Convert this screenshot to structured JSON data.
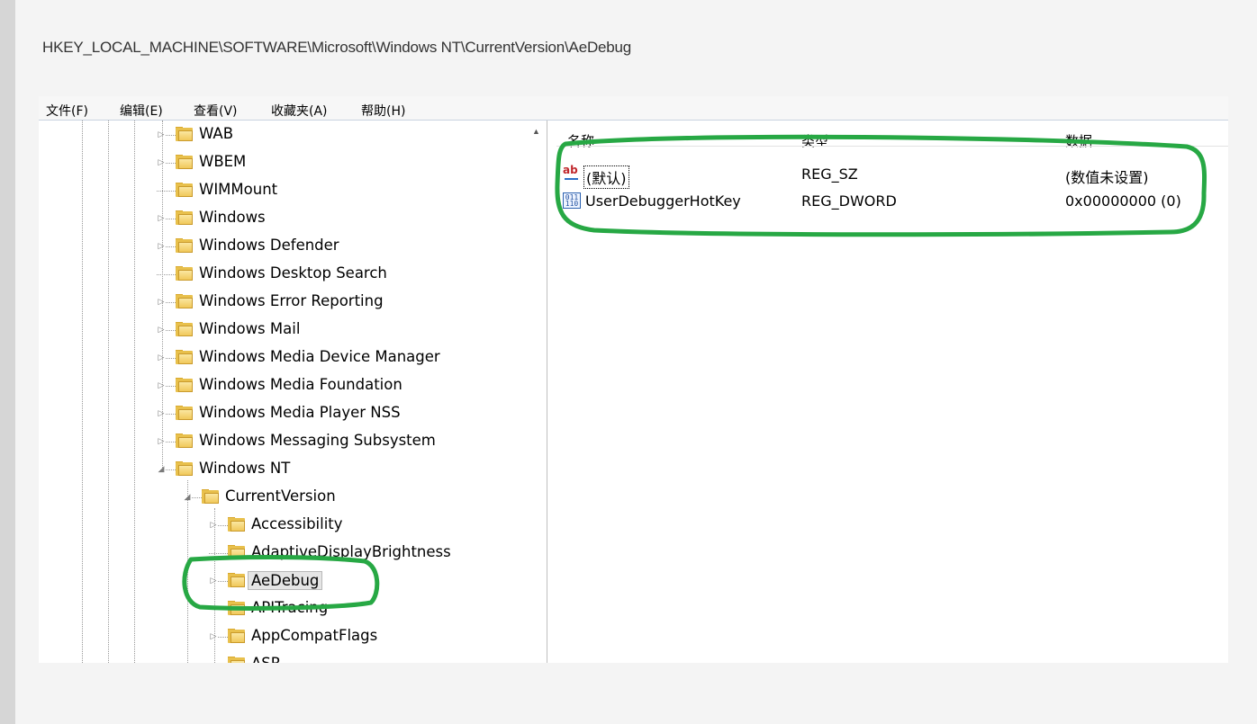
{
  "path": "HKEY_LOCAL_MACHINE\\SOFTWARE\\Microsoft\\Windows NT\\CurrentVersion\\AeDebug",
  "menu": [
    {
      "label": "文件(F)"
    },
    {
      "label": "编辑(E)"
    },
    {
      "label": "查看(V)"
    },
    {
      "label": "收藏夹(A)"
    },
    {
      "label": "帮助(H)"
    }
  ],
  "tree": [
    {
      "label": "WAB",
      "expander": "collapsed"
    },
    {
      "label": "WBEM",
      "expander": "collapsed"
    },
    {
      "label": "WIMMount",
      "expander": "none"
    },
    {
      "label": "Windows",
      "expander": "collapsed"
    },
    {
      "label": "Windows Defender",
      "expander": "collapsed"
    },
    {
      "label": "Windows Desktop Search",
      "expander": "none"
    },
    {
      "label": "Windows Error Reporting",
      "expander": "collapsed"
    },
    {
      "label": "Windows Mail",
      "expander": "collapsed"
    },
    {
      "label": "Windows Media Device Manager",
      "expander": "collapsed"
    },
    {
      "label": "Windows Media Foundation",
      "expander": "collapsed"
    },
    {
      "label": "Windows Media Player NSS",
      "expander": "collapsed"
    },
    {
      "label": "Windows Messaging Subsystem",
      "expander": "collapsed"
    },
    {
      "label": "Windows NT",
      "expander": "expanded"
    },
    {
      "label": "CurrentVersion",
      "expander": "expanded"
    },
    {
      "label": "Accessibility",
      "expander": "collapsed"
    },
    {
      "label": "AdaptiveDisplayBrightness",
      "expander": "none"
    },
    {
      "label": "AeDebug",
      "expander": "collapsed",
      "selected": true
    },
    {
      "label": "APITracing",
      "expander": "none"
    },
    {
      "label": "AppCompatFlags",
      "expander": "collapsed"
    },
    {
      "label": "ASR",
      "expander": "none"
    }
  ],
  "columns": {
    "name": "名称",
    "type": "类型",
    "data": "数据"
  },
  "values": [
    {
      "name": "(默认)",
      "type": "REG_SZ",
      "data": "(数值未设置)",
      "icon": "string-value-icon"
    },
    {
      "name": "UserDebuggerHotKey",
      "type": "REG_DWORD",
      "data": "0x00000000 (0)",
      "icon": "binary-value-icon"
    }
  ],
  "colors": {
    "annotation": "#27a844",
    "folder": "#f1c85a",
    "tree_line": "#999999"
  }
}
